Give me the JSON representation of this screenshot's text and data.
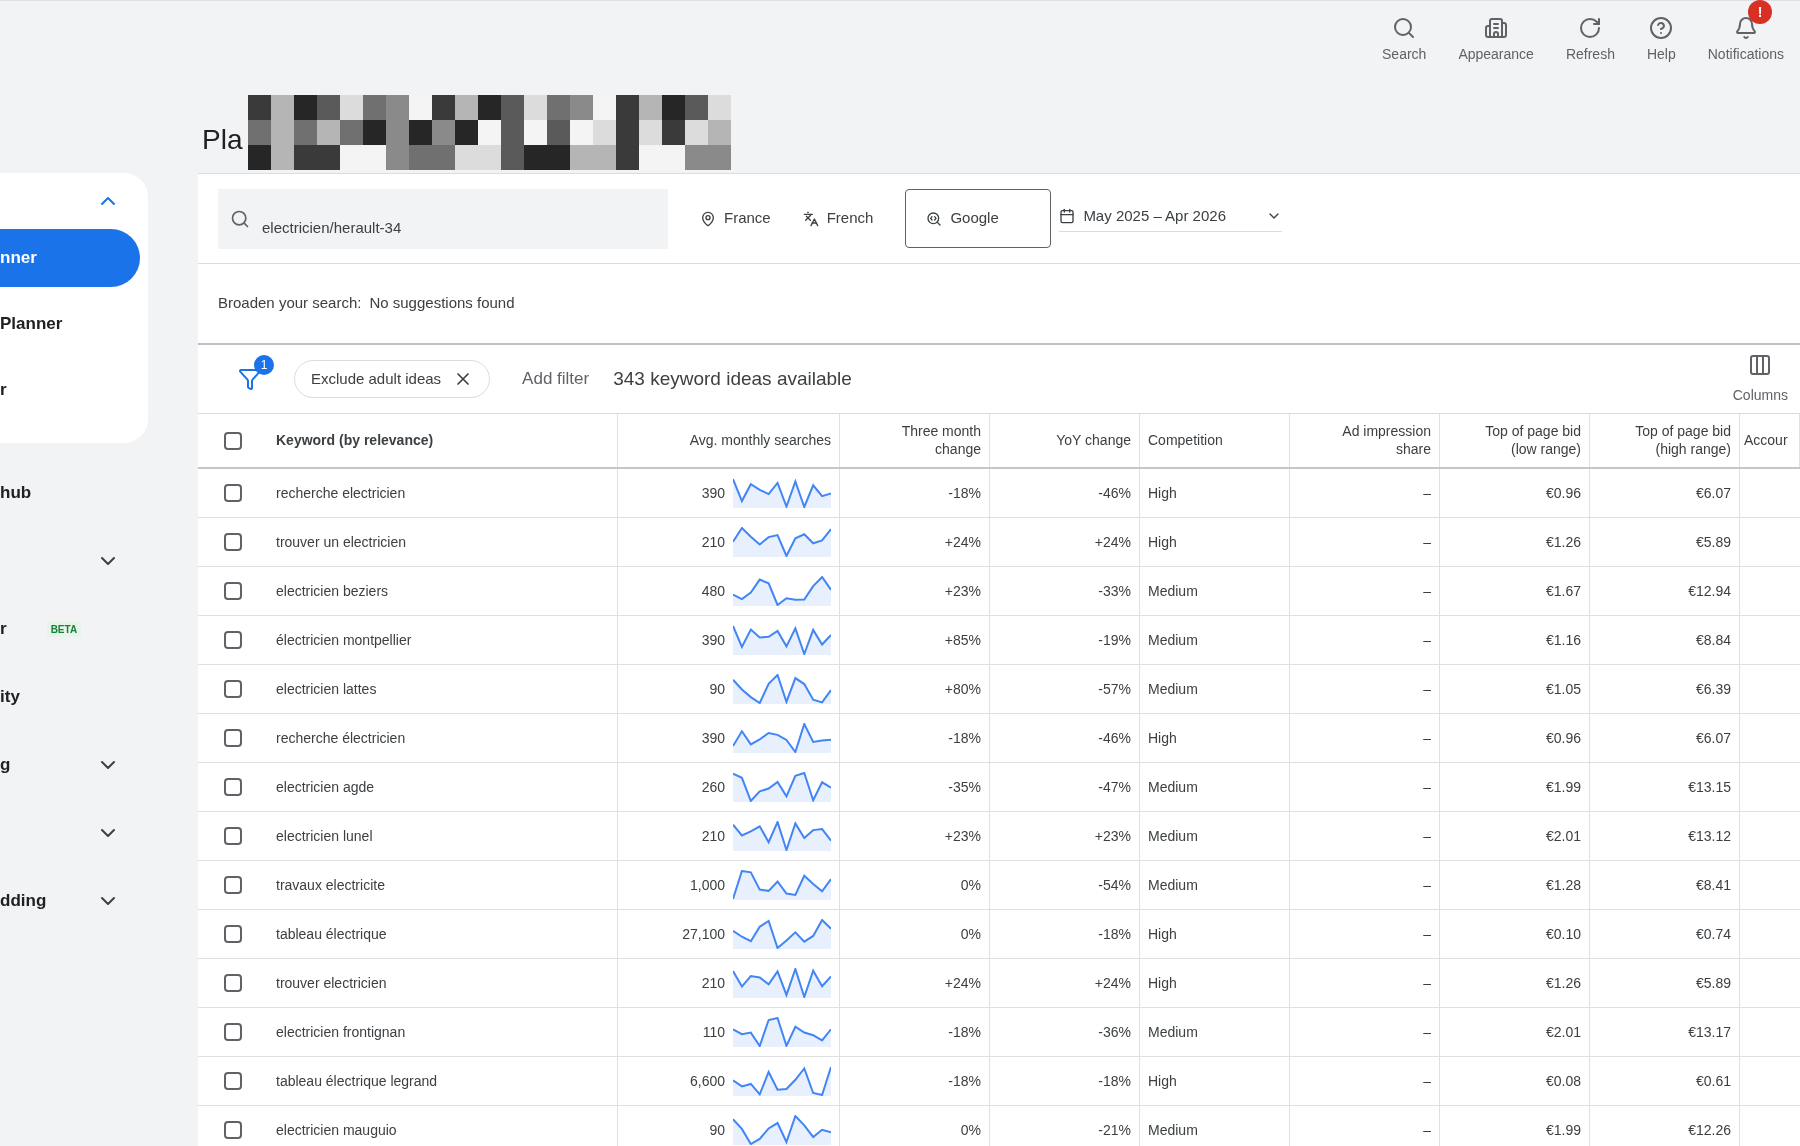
{
  "toolbar": [
    {
      "kind": "search",
      "label": "Search"
    },
    {
      "kind": "appearance",
      "label": "Appearance"
    },
    {
      "kind": "refresh",
      "label": "Refresh"
    },
    {
      "kind": "help",
      "label": "Help"
    },
    {
      "kind": "notifications",
      "label": "Notifications",
      "badge": "!"
    }
  ],
  "sidebar": {
    "card_items": [
      {
        "label": "nner",
        "selected": true
      },
      {
        "label": "Planner",
        "selected": false
      },
      {
        "label": "r",
        "selected": false
      }
    ],
    "card_expanded": true,
    "items": [
      {
        "label": "hub",
        "chevron": false
      },
      {
        "chevron": true
      },
      {
        "label": "r",
        "badge": "BETA",
        "chevron": false
      },
      {
        "label": "ity",
        "chevron": false
      },
      {
        "label": "g",
        "chevron": true
      },
      {
        "chevron": true
      },
      {
        "label": "dding",
        "chevron": true
      }
    ]
  },
  "page_title": "Pla",
  "search": {
    "value": "electricien/herault-34",
    "location": "France",
    "language": "French",
    "network": "Google",
    "date_range": "May 2025 – Apr 2026"
  },
  "broaden": {
    "label": "Broaden your search:",
    "value": "No suggestions found"
  },
  "filters": {
    "count": "1",
    "chip": "Exclude adult ideas",
    "add": "Add filter",
    "summary": "343 keyword ideas available",
    "columns_button": "Columns"
  },
  "table": {
    "select_all_checked": false,
    "columns": [
      "Keyword (by relevance)",
      "Avg. monthly searches",
      "Three month change",
      "YoY change",
      "Competition",
      "Ad impression share",
      "Top of page bid (low range)",
      "Top of page bid (high range)",
      "Accour"
    ],
    "rows": [
      {
        "keyword": "recherche electricien",
        "searches": "390",
        "three_month": "-18%",
        "yoy": "-46%",
        "competition": "High",
        "impression": "–",
        "low": "€0.96",
        "high": "€6.07",
        "checked": false
      },
      {
        "keyword": "trouver un electricien",
        "searches": "210",
        "three_month": "+24%",
        "yoy": "+24%",
        "competition": "High",
        "impression": "–",
        "low": "€1.26",
        "high": "€5.89",
        "checked": false
      },
      {
        "keyword": "electricien beziers",
        "searches": "480",
        "three_month": "+23%",
        "yoy": "-33%",
        "competition": "Medium",
        "impression": "–",
        "low": "€1.67",
        "high": "€12.94",
        "checked": false
      },
      {
        "keyword": "électricien montpellier",
        "searches": "390",
        "three_month": "+85%",
        "yoy": "-19%",
        "competition": "Medium",
        "impression": "–",
        "low": "€1.16",
        "high": "€8.84",
        "checked": false
      },
      {
        "keyword": "electricien lattes",
        "searches": "90",
        "three_month": "+80%",
        "yoy": "-57%",
        "competition": "Medium",
        "impression": "–",
        "low": "€1.05",
        "high": "€6.39",
        "checked": false
      },
      {
        "keyword": "recherche électricien",
        "searches": "390",
        "three_month": "-18%",
        "yoy": "-46%",
        "competition": "High",
        "impression": "–",
        "low": "€0.96",
        "high": "€6.07",
        "checked": false
      },
      {
        "keyword": "electricien agde",
        "searches": "260",
        "three_month": "-35%",
        "yoy": "-47%",
        "competition": "Medium",
        "impression": "–",
        "low": "€1.99",
        "high": "€13.15",
        "checked": false
      },
      {
        "keyword": "electricien lunel",
        "searches": "210",
        "three_month": "+23%",
        "yoy": "+23%",
        "competition": "Medium",
        "impression": "–",
        "low": "€2.01",
        "high": "€13.12",
        "checked": false
      },
      {
        "keyword": "travaux electricite",
        "searches": "1,000",
        "three_month": "0%",
        "yoy": "-54%",
        "competition": "Medium",
        "impression": "–",
        "low": "€1.28",
        "high": "€8.41",
        "checked": false
      },
      {
        "keyword": "tableau électrique",
        "searches": "27,100",
        "three_month": "0%",
        "yoy": "-18%",
        "competition": "High",
        "impression": "–",
        "low": "€0.10",
        "high": "€0.74",
        "checked": false
      },
      {
        "keyword": "trouver electricien",
        "searches": "210",
        "three_month": "+24%",
        "yoy": "+24%",
        "competition": "High",
        "impression": "–",
        "low": "€1.26",
        "high": "€5.89",
        "checked": false
      },
      {
        "keyword": "electricien frontignan",
        "searches": "110",
        "three_month": "-18%",
        "yoy": "-36%",
        "competition": "Medium",
        "impression": "–",
        "low": "€2.01",
        "high": "€13.17",
        "checked": false
      },
      {
        "keyword": "tableau électrique legrand",
        "searches": "6,600",
        "three_month": "-18%",
        "yoy": "-18%",
        "competition": "High",
        "impression": "–",
        "low": "€0.08",
        "high": "€0.61",
        "checked": false
      },
      {
        "keyword": "electricien mauguio",
        "searches": "90",
        "three_month": "0%",
        "yoy": "-21%",
        "competition": "Medium",
        "impression": "–",
        "low": "€1.99",
        "high": "€12.26",
        "checked": false
      }
    ]
  }
}
